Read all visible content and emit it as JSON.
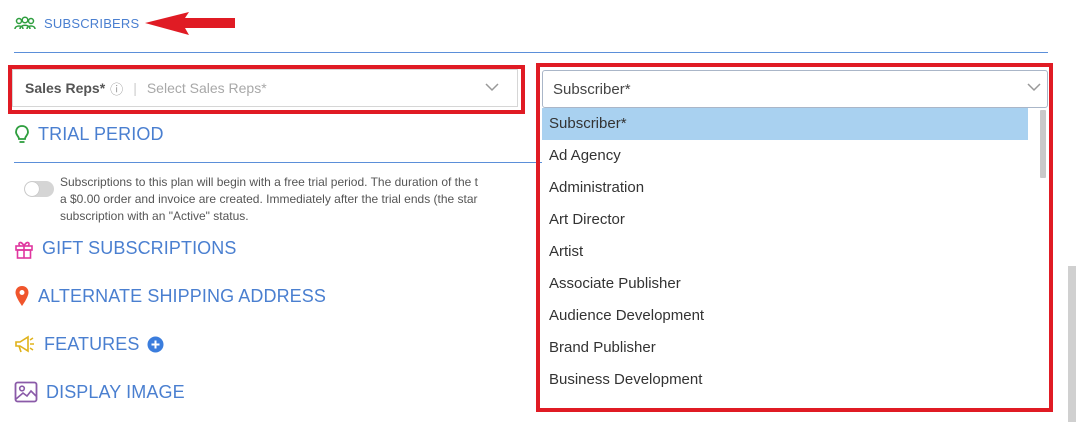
{
  "subscribers": {
    "label": "SUBSCRIBERS"
  },
  "sales_reps": {
    "label": "Sales Reps*",
    "info_icon": "ⓘ",
    "separator": "|",
    "placeholder": "Select Sales Reps*"
  },
  "trial": {
    "title": "TRIAL PERIOD",
    "description": "Subscriptions to this plan will begin with a free trial period. The duration of the t\na $0.00 order and invoice are created. Immediately after the trial ends (the star\nsubscription with an \"Active\" status."
  },
  "sections": {
    "gift": "GIFT SUBSCRIPTIONS",
    "alt_shipping": "ALTERNATE SHIPPING ADDRESS",
    "features": "FEATURES",
    "display_image": "DISPLAY IMAGE"
  },
  "role_dropdown": {
    "selected": "Subscriber*",
    "options": [
      "Subscriber*",
      "Ad Agency",
      "Administration",
      "Art Director",
      "Artist",
      "Associate Publisher",
      "Audience Development",
      "Brand Publisher",
      "Business Development"
    ]
  },
  "colors": {
    "accent": "#4a7fd0",
    "highlight_red": "#e01b24",
    "selected_option": "#a9d1f0",
    "green_icon": "#2e9e3e",
    "gift_pink": "#e0369f",
    "pin_orange": "#f0552c",
    "megaphone_yellow": "#e0b21a",
    "image_purple": "#8a5aa8"
  }
}
